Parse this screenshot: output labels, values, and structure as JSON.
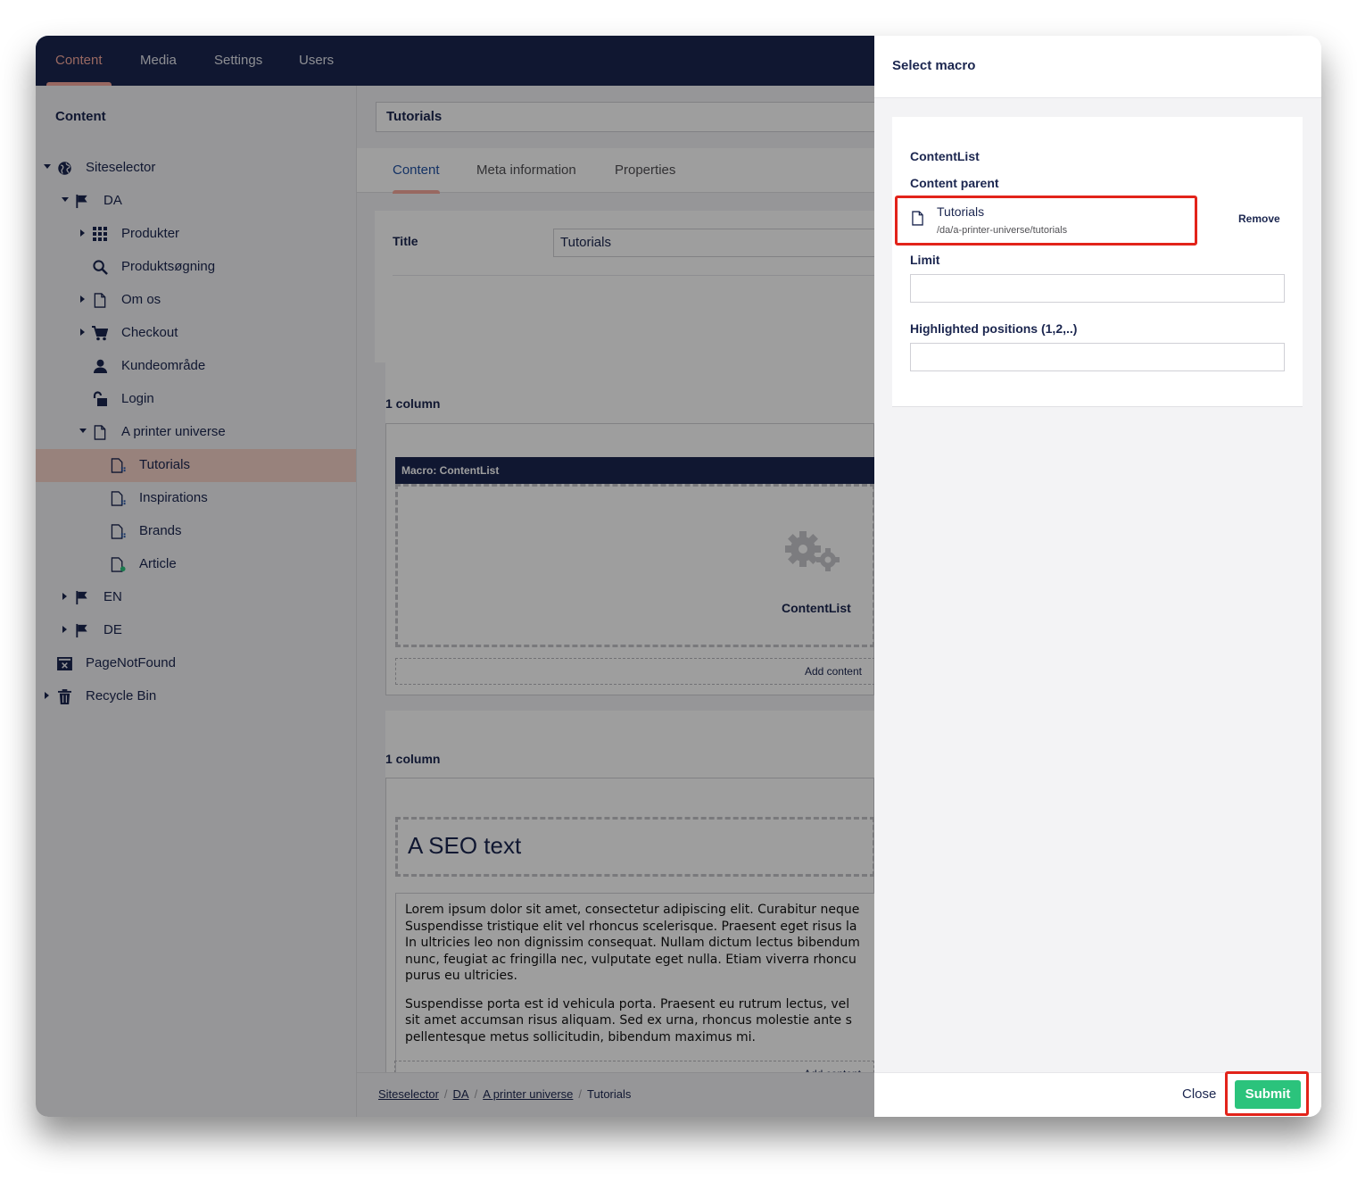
{
  "nav": {
    "tabs": [
      "Content",
      "Media",
      "Settings",
      "Users"
    ],
    "active": "Content"
  },
  "tree": {
    "header": "Content",
    "nodes": [
      {
        "label": "Siteselector",
        "icon": "globe-icon"
      },
      {
        "label": "DA",
        "icon": "flag-icon"
      },
      {
        "label": "Produkter",
        "icon": "grid-icon"
      },
      {
        "label": "Produktsøgning",
        "icon": "search-icon"
      },
      {
        "label": "Om os",
        "icon": "document-icon"
      },
      {
        "label": "Checkout",
        "icon": "cart-icon"
      },
      {
        "label": "Kundeområde",
        "icon": "user-icon"
      },
      {
        "label": "Login",
        "icon": "unlock-icon"
      },
      {
        "label": "A printer universe",
        "icon": "document-icon"
      },
      {
        "label": "Tutorials",
        "icon": "document-list-icon"
      },
      {
        "label": "Inspirations",
        "icon": "document-list-icon"
      },
      {
        "label": "Brands",
        "icon": "document-list-icon"
      },
      {
        "label": "Article",
        "icon": "document-add-icon"
      },
      {
        "label": "EN",
        "icon": "flag-icon"
      },
      {
        "label": "DE",
        "icon": "flag-icon"
      },
      {
        "label": "PageNotFound",
        "icon": "page-not-found-icon"
      },
      {
        "label": "Recycle Bin",
        "icon": "trash-icon"
      }
    ]
  },
  "editor": {
    "node_name": "Tutorials",
    "tabs": [
      "Content",
      "Meta information",
      "Properties"
    ],
    "title_label": "Title",
    "title_value": "Tutorials",
    "section1_label": "1 column",
    "macro_bar": "Macro: ContentList",
    "macro_name": "ContentList",
    "add_content": "Add content",
    "section2_label": "1 column",
    "seo_heading": "A SEO text",
    "lorem_p1": [
      "Lorem ipsum dolor sit amet, consectetur adipiscing elit. Curabitur neque",
      "Suspendisse tristique elit vel rhoncus scelerisque. Praesent eget risus la",
      "In ultricies leo non dignissim consequat. Nullam dictum lectus bibendum",
      "nunc, feugiat ac fringilla nec, vulputate eget nulla. Etiam viverra rhoncu",
      "purus eu ultricies."
    ],
    "lorem_p2": [
      "Suspendisse porta est id vehicula porta. Praesent eu rutrum lectus, vel",
      "sit amet accumsan risus aliquam. Sed ex urna, rhoncus molestie ante s",
      "pellentesque metus sollicitudin, bibendum maximus mi."
    ],
    "add_content_2": "Add content"
  },
  "breadcrumb": [
    "Siteselector",
    "DA",
    "A printer universe",
    "Tutorials"
  ],
  "panel": {
    "title": "Select macro",
    "macro_title": "ContentList",
    "content_parent_label": "Content parent",
    "picked_name": "Tutorials",
    "picked_path": "/da/a-printer-universe/tutorials",
    "remove_label": "Remove",
    "limit_label": "Limit",
    "limit_value": "",
    "highlighted_label": "Highlighted positions (1,2,..)",
    "highlighted_value": "",
    "close_label": "Close",
    "submit_label": "Submit"
  },
  "colors": {
    "nav_bg": "#1b264f",
    "accent": "#f5a99d",
    "submit": "#2bc37c",
    "highlight_box": "#e2231a"
  }
}
